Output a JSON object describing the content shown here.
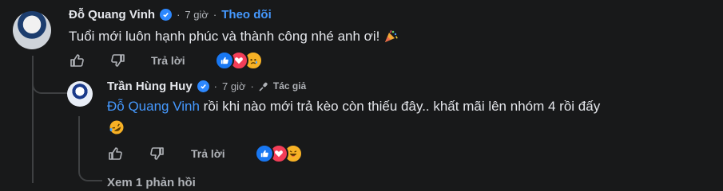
{
  "comment": {
    "author": "Đỗ Quang Vinh",
    "time": "7 giờ",
    "follow_label": "Theo dõi",
    "text": "Tuổi mới luôn hạnh phúc và thành công nhé anh ơi!",
    "reply_label": "Trả lời",
    "reactions": [
      "like-icon",
      "love-icon",
      "sad-icon"
    ]
  },
  "reply": {
    "author": "Trần Hùng Huy",
    "time": "7 giờ",
    "badge": "Tác giả",
    "mention": "Đỗ Quang Vinh",
    "text_line1": " rồi khi nào mới trả kèo còn thiếu đây.. khất mãi lên nhóm 4 rồi đấy",
    "reply_label": "Trả lời",
    "reactions": [
      "like-icon",
      "love-icon",
      "haha-icon"
    ]
  },
  "view_replies_label": "Xem 1 phản hồi",
  "colors": {
    "background": "#18191a",
    "link": "#4599ff",
    "muted": "#b0b3b8",
    "text": "#e4e6eb",
    "verified": "#2d88ff"
  }
}
